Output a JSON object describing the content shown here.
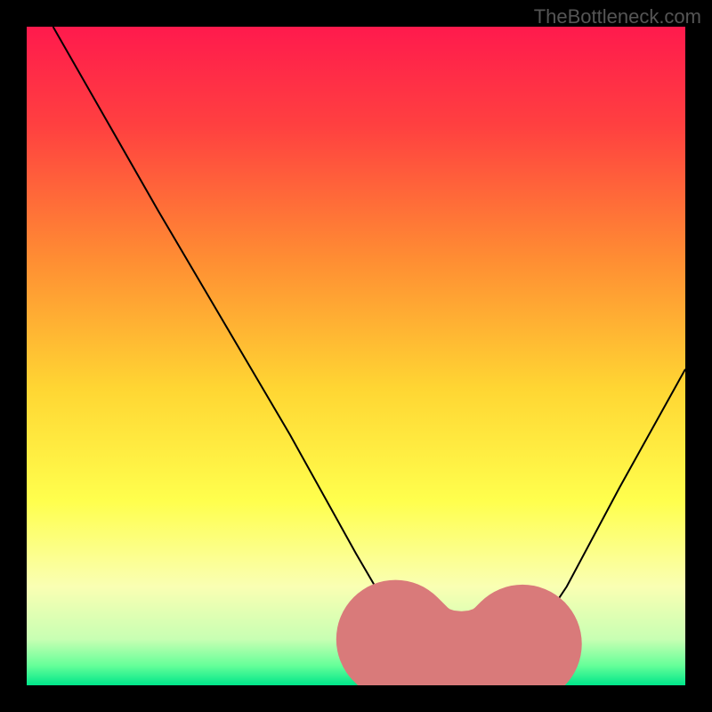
{
  "watermark": "TheBottleneck.com",
  "chart_data": {
    "type": "line",
    "title": "",
    "xlabel": "",
    "ylabel": "",
    "xlim": [
      0,
      100
    ],
    "ylim": [
      0,
      100
    ],
    "background_gradient": {
      "stops": [
        {
          "offset": 0.0,
          "color": "#ff1a4d"
        },
        {
          "offset": 0.15,
          "color": "#ff4040"
        },
        {
          "offset": 0.35,
          "color": "#ff8c33"
        },
        {
          "offset": 0.55,
          "color": "#ffd633"
        },
        {
          "offset": 0.72,
          "color": "#ffff4d"
        },
        {
          "offset": 0.85,
          "color": "#faffb3"
        },
        {
          "offset": 0.93,
          "color": "#c8ffb3"
        },
        {
          "offset": 0.97,
          "color": "#66ff99"
        },
        {
          "offset": 1.0,
          "color": "#00e68a"
        }
      ]
    },
    "series": [
      {
        "name": "bottleneck-curve",
        "color": "#000000",
        "points": [
          {
            "x": 4,
            "y": 100
          },
          {
            "x": 12,
            "y": 86
          },
          {
            "x": 20,
            "y": 72
          },
          {
            "x": 30,
            "y": 55
          },
          {
            "x": 40,
            "y": 38
          },
          {
            "x": 50,
            "y": 20
          },
          {
            "x": 57,
            "y": 8
          },
          {
            "x": 60,
            "y": 4
          },
          {
            "x": 63,
            "y": 2
          },
          {
            "x": 68,
            "y": 2
          },
          {
            "x": 72,
            "y": 3
          },
          {
            "x": 76,
            "y": 6
          },
          {
            "x": 82,
            "y": 15
          },
          {
            "x": 90,
            "y": 30
          },
          {
            "x": 100,
            "y": 48
          }
        ]
      },
      {
        "name": "highlight-band",
        "color": "#d97a7a",
        "thick": true,
        "points": [
          {
            "x": 56,
            "y": 7
          },
          {
            "x": 58,
            "y": 5
          },
          {
            "x": 60,
            "y": 3.5
          },
          {
            "x": 63,
            "y": 2.5
          },
          {
            "x": 66,
            "y": 2.2
          },
          {
            "x": 69,
            "y": 2.5
          },
          {
            "x": 72,
            "y": 3.5
          },
          {
            "x": 74,
            "y": 5
          },
          {
            "x": 76,
            "y": 7
          }
        ]
      }
    ]
  }
}
